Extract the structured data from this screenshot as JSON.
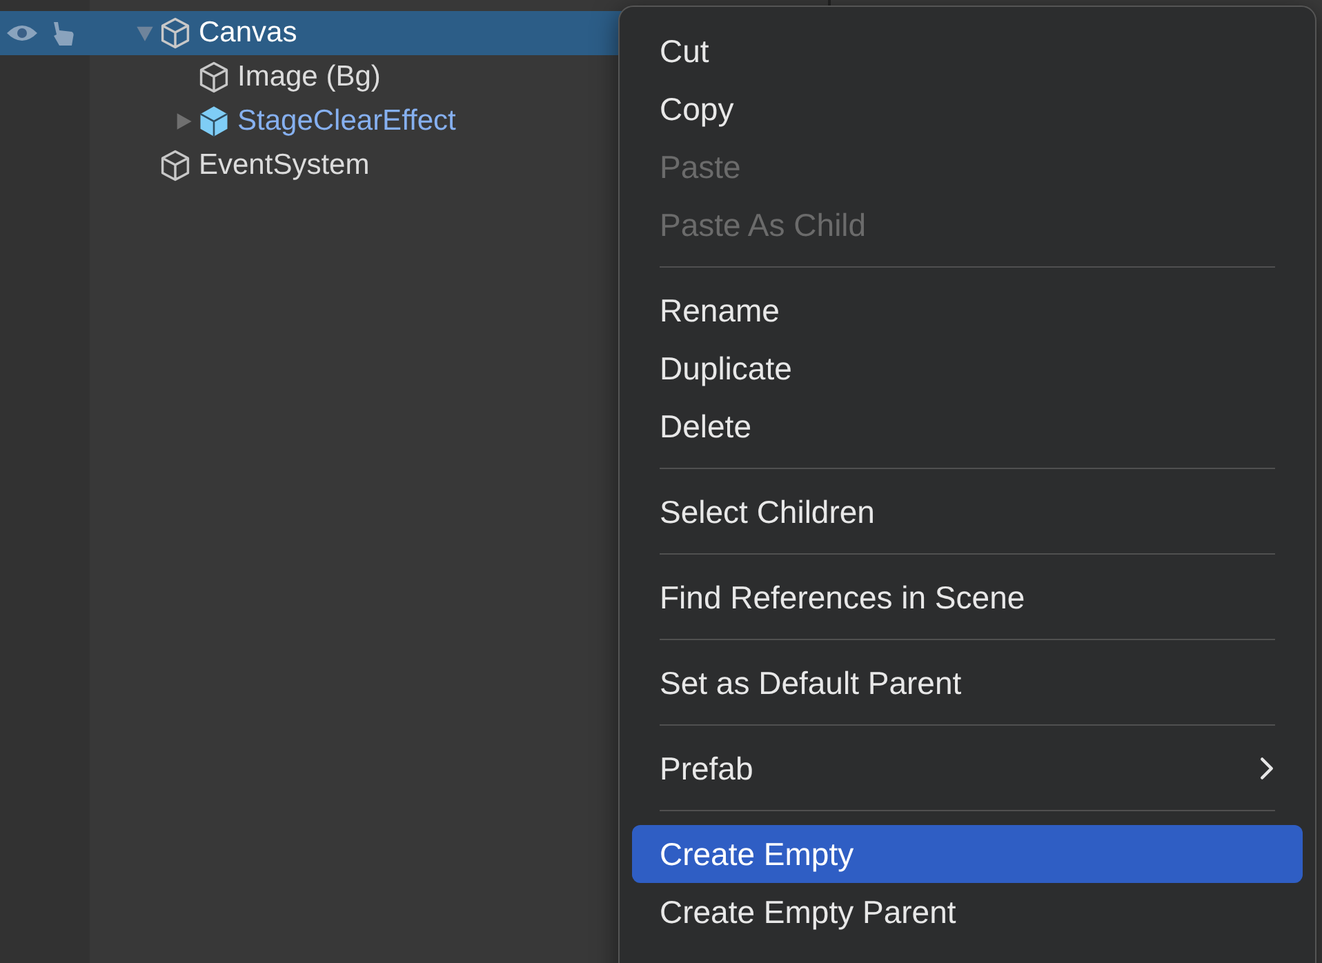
{
  "hierarchy": {
    "items": [
      {
        "label": "Canvas",
        "kind": "object",
        "selected": true,
        "expanded": true,
        "toggles_visible": true,
        "children": [
          {
            "label": "Image (Bg)",
            "kind": "object",
            "selected": false,
            "toggles_visible": false
          },
          {
            "label": "StageClearEffect",
            "kind": "prefab",
            "selected": false,
            "expanded": false,
            "toggles_visible": false
          }
        ]
      },
      {
        "label": "EventSystem",
        "kind": "object",
        "selected": false,
        "toggles_visible": false
      }
    ]
  },
  "context_menu": {
    "items": [
      {
        "kind": "item",
        "label": "Cut",
        "disabled": false,
        "selected": false
      },
      {
        "kind": "item",
        "label": "Copy",
        "disabled": false,
        "selected": false
      },
      {
        "kind": "item",
        "label": "Paste",
        "disabled": true,
        "selected": false
      },
      {
        "kind": "item",
        "label": "Paste As Child",
        "disabled": true,
        "selected": false
      },
      {
        "kind": "separator"
      },
      {
        "kind": "item",
        "label": "Rename",
        "disabled": false,
        "selected": false
      },
      {
        "kind": "item",
        "label": "Duplicate",
        "disabled": false,
        "selected": false
      },
      {
        "kind": "item",
        "label": "Delete",
        "disabled": false,
        "selected": false
      },
      {
        "kind": "separator"
      },
      {
        "kind": "item",
        "label": "Select Children",
        "disabled": false,
        "selected": false
      },
      {
        "kind": "separator"
      },
      {
        "kind": "item",
        "label": "Find References in Scene",
        "disabled": false,
        "selected": false
      },
      {
        "kind": "separator"
      },
      {
        "kind": "item",
        "label": "Set as Default Parent",
        "disabled": false,
        "selected": false
      },
      {
        "kind": "separator"
      },
      {
        "kind": "submenu",
        "label": "Prefab",
        "disabled": false,
        "selected": false
      },
      {
        "kind": "separator"
      },
      {
        "kind": "item",
        "label": "Create Empty",
        "disabled": false,
        "selected": true
      },
      {
        "kind": "item",
        "label": "Create Empty Parent",
        "disabled": false,
        "selected": false
      }
    ]
  }
}
